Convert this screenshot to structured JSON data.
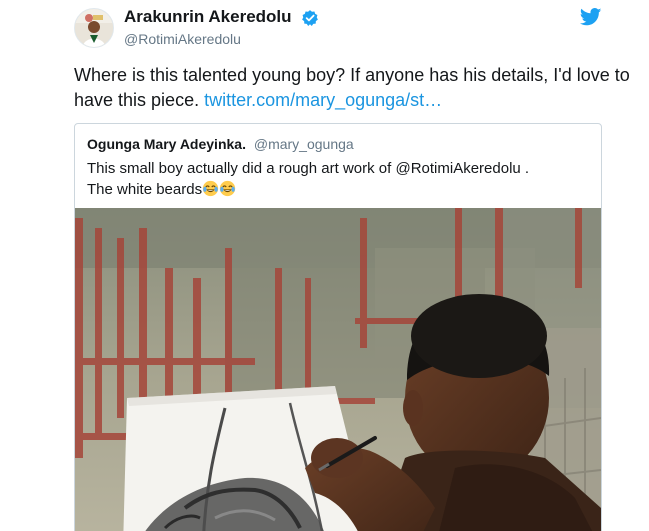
{
  "author": {
    "display_name": "Arakunrin Akeredolu",
    "handle": "@RotimiAkeredolu",
    "verified": true
  },
  "tweet": {
    "text": "Where is this talented young boy? If anyone has his details, I'd love to have this piece. ",
    "link_text": "twitter.com/mary_ogunga/st…"
  },
  "quoted_tweet": {
    "display_name": "Ogunga Mary Adeyinka.",
    "handle": "@mary_ogunga",
    "line1": "This small boy actually did a rough art work of @RotimiAkeredolu .",
    "line2": "The white beards",
    "emojis": [
      "face-with-tears-of-joy",
      "face-with-tears-of-joy"
    ]
  },
  "icons": {
    "verified": "verified-badge-icon",
    "brand": "twitter-bird-icon"
  },
  "colors": {
    "link": "#1b95e0",
    "verified": "#1da1f2",
    "brand": "#1da1f2",
    "secondary_text": "#657786"
  }
}
